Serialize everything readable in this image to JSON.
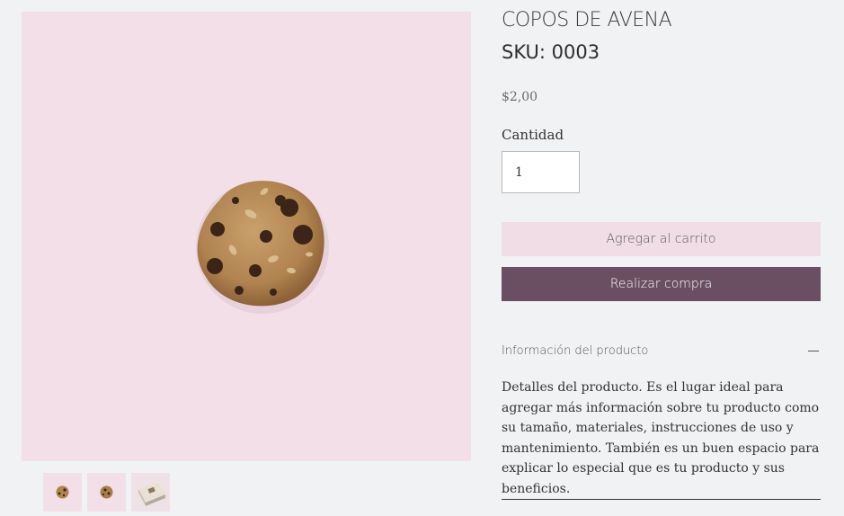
{
  "product": {
    "name": "COPOS DE AVENA",
    "sku": "SKU: 0003",
    "price": "$2,00"
  },
  "gallery": {
    "main_image": "cookie-photo",
    "thumbnails": [
      "cookie-thumb",
      "cookie-thumb",
      "gift-box-thumb"
    ]
  },
  "quantity": {
    "label": "Cantidad",
    "value": "1"
  },
  "buttons": {
    "add_to_cart": "Agregar al carrito",
    "buy_now": "Realizar compra"
  },
  "info_section": {
    "title": "Información del producto",
    "toggle_icon": "minus-icon",
    "body": "Detalles del producto. Es el lugar ideal para agregar más información sobre tu producto como su tamaño, materiales, instrucciones de uso y mantenimiento. También es un buen espacio para explicar lo especial que es tu producto y sus beneficios."
  },
  "colors": {
    "background": "#f1f2f4",
    "image_bg": "#f2dfe8",
    "cart_button": "#f0dde6",
    "buy_button": "#6a4f63"
  }
}
